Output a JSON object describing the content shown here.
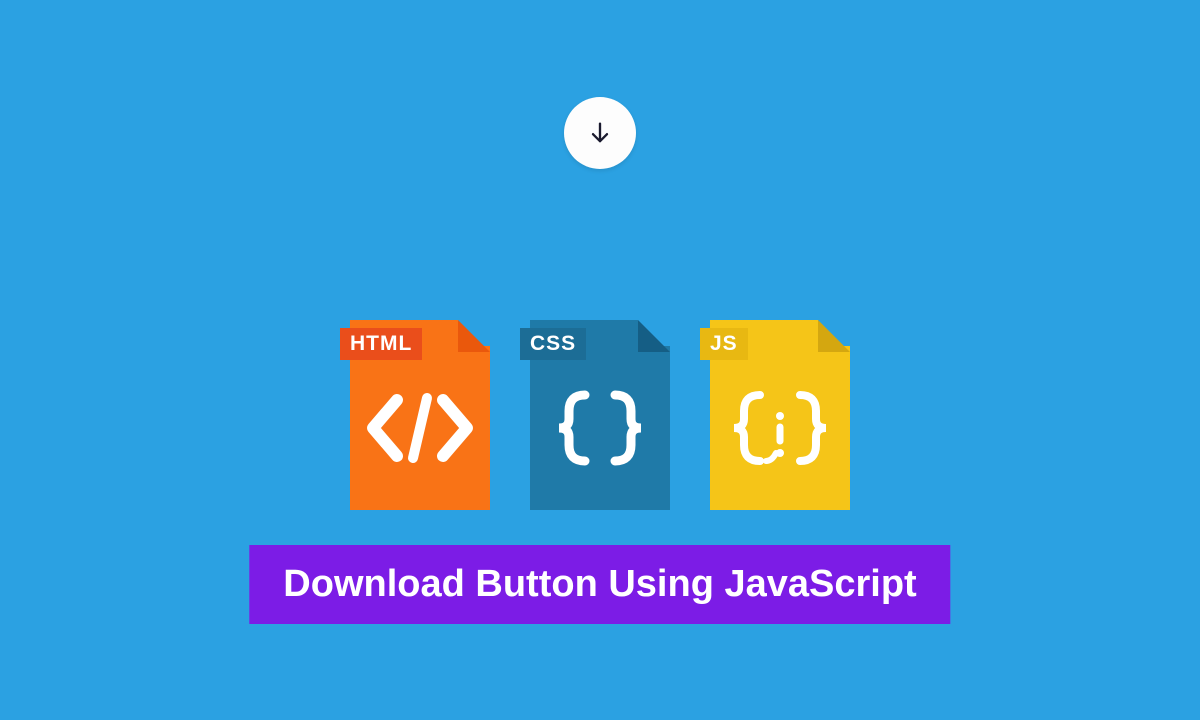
{
  "download_button": {
    "icon_name": "arrow-down"
  },
  "files": {
    "html": {
      "label": "HTML",
      "symbol": "</>"
    },
    "css": {
      "label": "CSS",
      "symbol": "{ }"
    },
    "js": {
      "label": "JS",
      "symbol": "{i}"
    }
  },
  "title": "Download Button Using JavaScript"
}
